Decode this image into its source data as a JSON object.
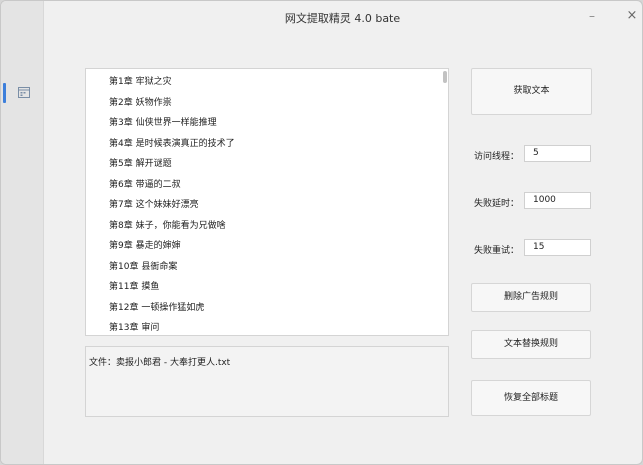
{
  "window": {
    "title": "网文提取精灵 4.0 bate",
    "minimize_glyph": "–",
    "close_glyph": "×"
  },
  "sidebar": {
    "icon": "calendar-icon",
    "accent_color": "#3d7fdb"
  },
  "chapters": [
    "第1章 牢狱之灾",
    "第2章 妖物作祟",
    "第3章 仙侠世界一样能推理",
    "第4章 是时候表演真正的技术了",
    "第5章 解开谜题",
    "第6章 带逼的二叔",
    "第7章 这个妹妹好漂亮",
    "第8章 妹子，你能看为兄做啥",
    "第9章 暴走的婶婶",
    "第10章 县衙命案",
    "第11章 摸鱼",
    "第12章 一顿操作猛如虎",
    "第13章 审问"
  ],
  "file_info": "文件：卖报小郎君 - 大奉打更人.txt",
  "buttons": {
    "fetch": "获取文本",
    "delete_ads": "删除广告规则",
    "replace_text": "文本替换规则",
    "restore_titles": "恢复全部标题"
  },
  "fields": {
    "threads": {
      "label": "访问线程：",
      "value": "5"
    },
    "fail_delay": {
      "label": "失败延时：",
      "value": "1000"
    },
    "fail_retry": {
      "label": "失败重试：",
      "value": "15"
    }
  }
}
